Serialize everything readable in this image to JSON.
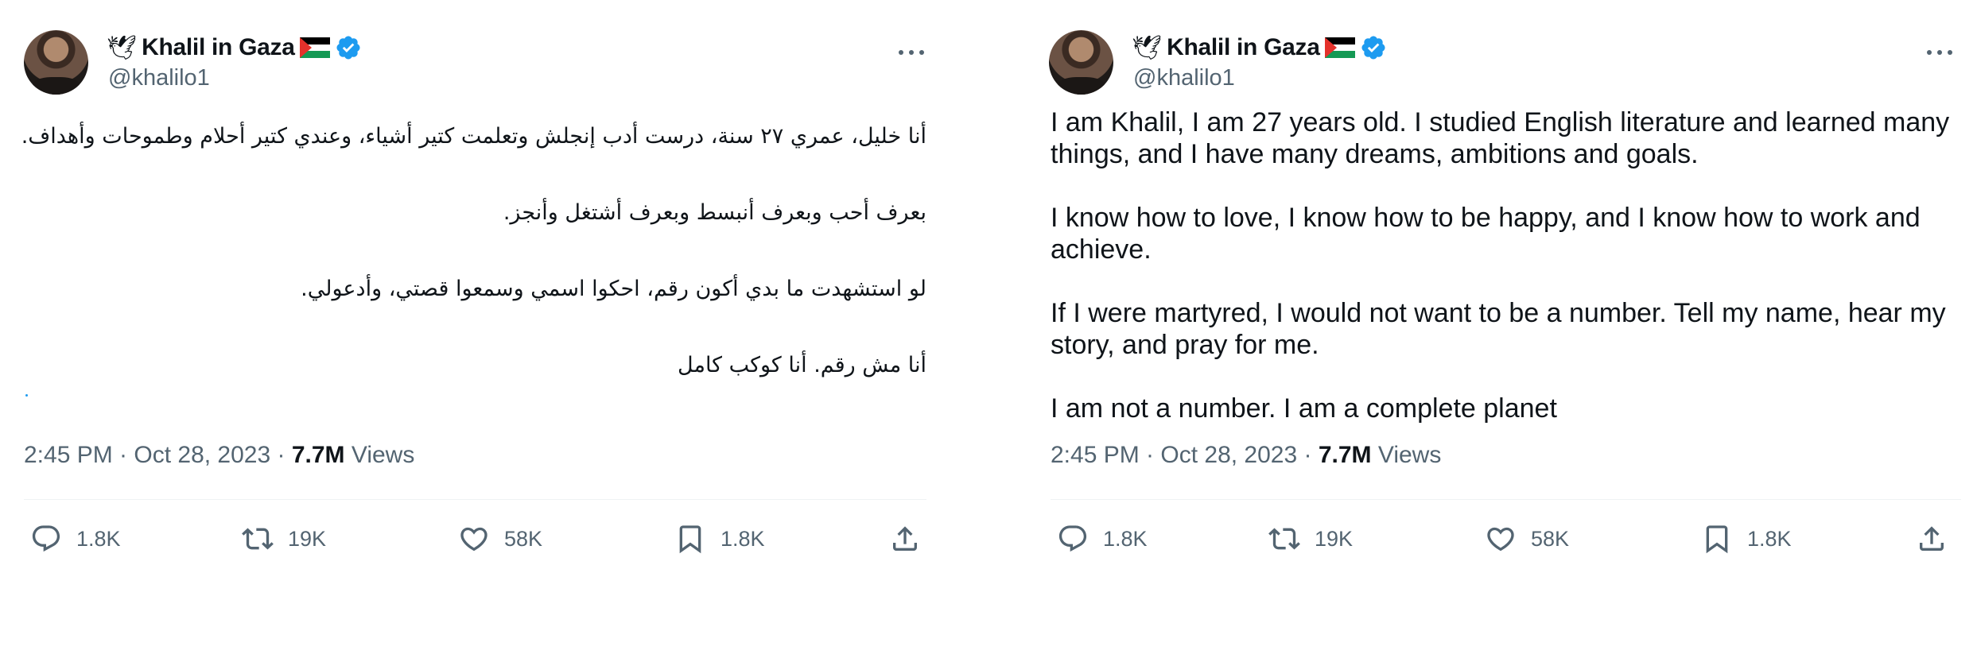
{
  "colors": {
    "verified": "#1d9bf0",
    "secondary_text": "#536471",
    "primary_text": "#0f1419",
    "divider": "#eff3f4"
  },
  "tweets": [
    {
      "author": {
        "prefix": "🕊",
        "name": "Khalil in Gaza",
        "flag": "palestine-flag",
        "verified": true,
        "handle": "@khalilo1"
      },
      "paragraphs": [
        "أنا خليل، عمري ٢٧ سنة، درست أدب إنجلش وتعلمت كتير أشياء، وعندي كتير أحلام وطموحات وأهداف.",
        "بعرف أحب وبعرف أنبسط وبعرف أشتغل وأنجز.",
        "لو استشهدت ما بدي أكون رقم، احكوا اسمي وسمعوا قصتي، وأدعولي.",
        "أنا مش رقم. أنا كوكب كامل"
      ],
      "time": "2:45 PM · Oct 28, 2023 · ",
      "views_count": "7.7M",
      "views_label": " Views",
      "actions": {
        "replies": "1.8K",
        "reposts": "19K",
        "likes": "58K",
        "bookmarks": "1.8K"
      }
    },
    {
      "author": {
        "prefix": "🕊",
        "name": "Khalil in Gaza",
        "flag": "palestine-flag",
        "verified": true,
        "handle": "@khalilo1"
      },
      "paragraphs": [
        "I am Khalil, I am 27 years old. I studied English literature and learned many things, and I have many dreams, ambitions and goals.",
        "I know how to love, I know how to be happy, and I know how to work and achieve.",
        "If I were martyred, I would not want to be a number. Tell my name, hear my story, and pray for me.",
        "I am not a number. I am a complete planet"
      ],
      "time": "2:45 PM · Oct 28, 2023 · ",
      "views_count": "7.7M",
      "views_label": " Views",
      "actions": {
        "replies": "1.8K",
        "reposts": "19K",
        "likes": "58K",
        "bookmarks": "1.8K"
      }
    }
  ]
}
